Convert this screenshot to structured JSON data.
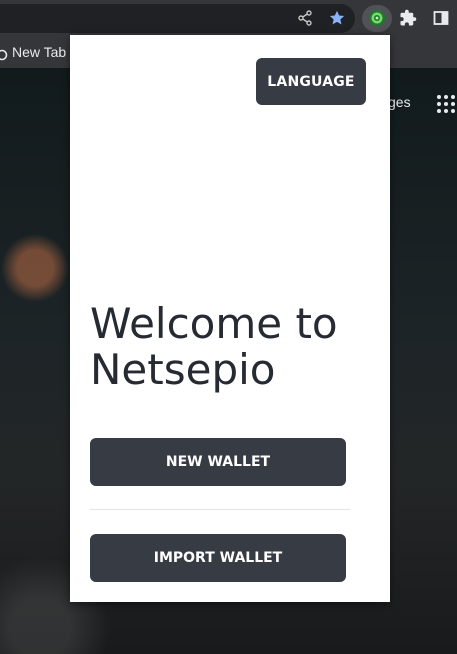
{
  "browser": {
    "bookmarks": [
      {
        "label": "New Tab",
        "icon": "new-tab-icon"
      }
    ],
    "newtab_link_label": "ges",
    "toolbar_icons": [
      "share-icon",
      "bookmark-star-icon",
      "netsepio-extension-icon",
      "extensions-puzzle-icon",
      "side-panel-icon",
      "apps-grid-icon"
    ],
    "colors": {
      "toolbar": "#35363a",
      "star": "#8ab4f8",
      "extension_accent": "#4caf50"
    }
  },
  "popup": {
    "language_label": "LANGUAGE",
    "headline": "Welcome to Netsepio",
    "new_wallet_label": "NEW WALLET",
    "import_wallet_label": "IMPORT WALLET",
    "colors": {
      "button_bg": "#373b44",
      "button_text": "#ffffff",
      "headline": "#262a33",
      "background": "#ffffff"
    }
  }
}
